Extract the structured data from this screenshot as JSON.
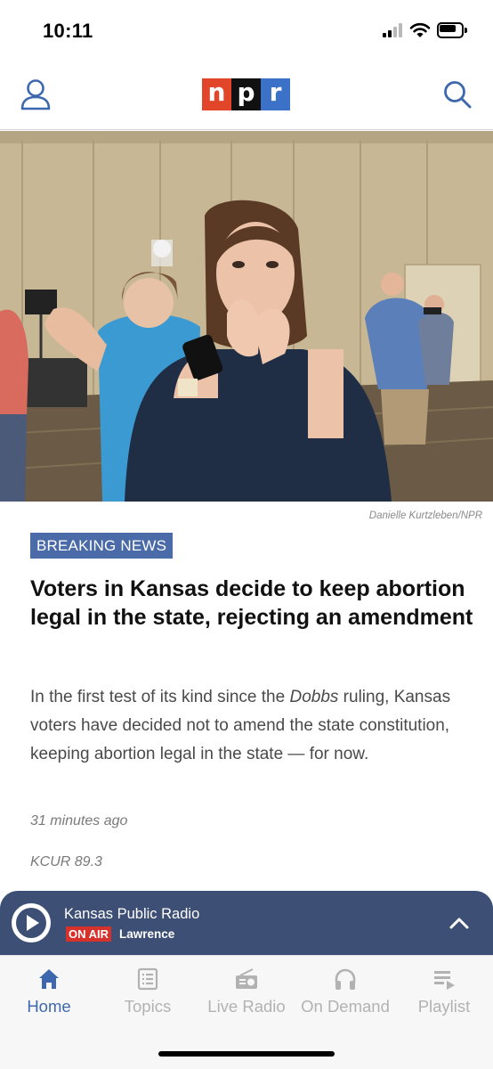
{
  "status_bar": {
    "time": "10:11"
  },
  "header": {
    "logo_letters": [
      "n",
      "p",
      "r"
    ],
    "colors": {
      "n": "#e2462a",
      "p": "#111111",
      "r": "#3b72c8"
    },
    "profile_icon": "person-icon",
    "search_icon": "search-icon"
  },
  "hero": {
    "photo_credit": "Danielle Kurtzleben/NPR"
  },
  "article": {
    "badge": "BREAKING NEWS",
    "headline": "Voters in Kansas decide to keep abortion legal in the state, rejecting an amendment",
    "teaser_before": "In the first test of its kind since the ",
    "teaser_italic": "Dobbs",
    "teaser_after": " ruling, Kansas voters have decided not to amend the state constitution, keeping abortion legal in the state — for now.",
    "timestamp": "31 minutes ago",
    "station": "KCUR 89.3"
  },
  "player": {
    "title": "Kansas Public Radio",
    "on_air": "ON AIR",
    "location": "Lawrence",
    "play_icon": "play-icon",
    "expand_icon": "chevron-up-icon",
    "background": "#3d4f74"
  },
  "tabs": [
    {
      "label": "Home",
      "icon": "home-icon",
      "active": true
    },
    {
      "label": "Topics",
      "icon": "list-icon",
      "active": false
    },
    {
      "label": "Live Radio",
      "icon": "radio-icon",
      "active": false
    },
    {
      "label": "On Demand",
      "icon": "headphones-icon",
      "active": false
    },
    {
      "label": "Playlist",
      "icon": "playlist-icon",
      "active": false
    }
  ],
  "accent_color": "#3e68ad"
}
